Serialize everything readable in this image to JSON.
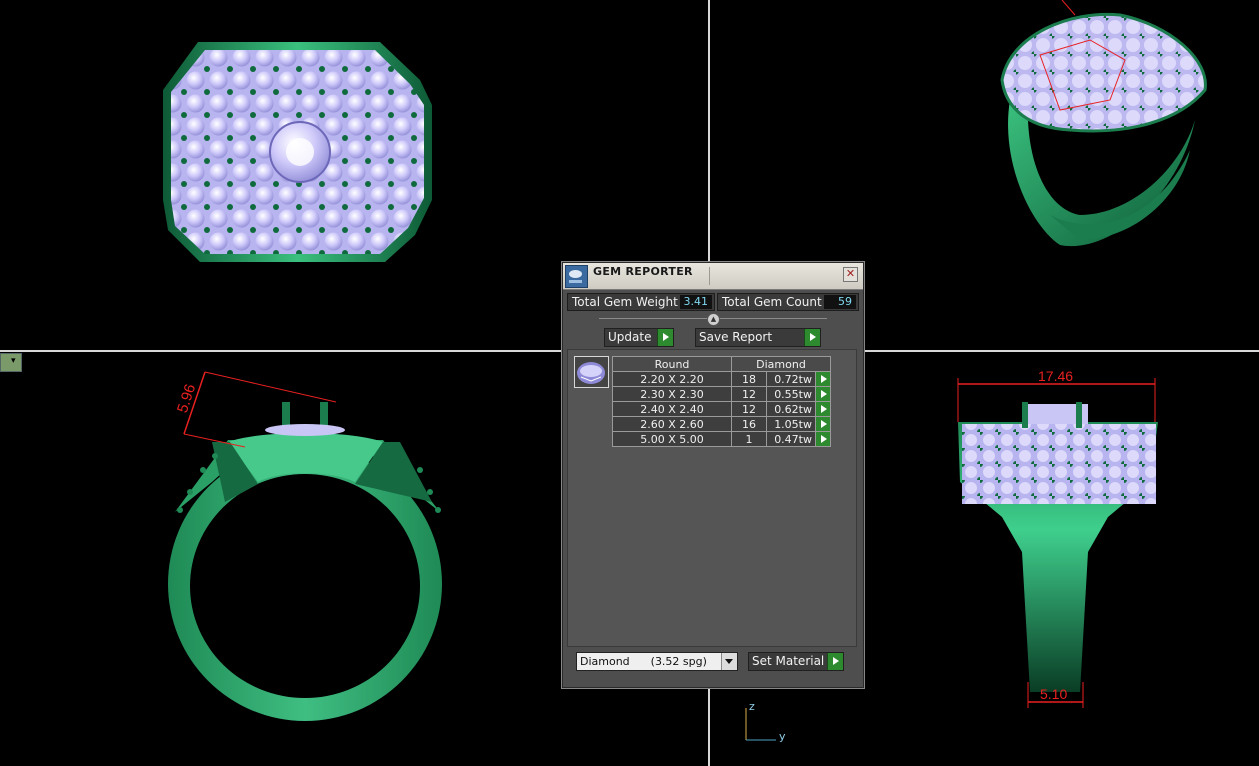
{
  "dialog": {
    "title": "GEM REPORTER",
    "close_label": "✕",
    "total_gem_weight_label": "Total Gem Weight",
    "total_gem_weight_value": "3.41",
    "total_gem_count_label": "Total Gem Count",
    "total_gem_count_value": "59",
    "update_label": "Update",
    "save_report_label": "Save Report",
    "table": {
      "headers": [
        "Round",
        "Diamond"
      ],
      "rows": [
        {
          "size": "2.20 X 2.20",
          "qty": "18",
          "weight": "0.72tw"
        },
        {
          "size": "2.30 X 2.30",
          "qty": "12",
          "weight": "0.55tw"
        },
        {
          "size": "2.40 X 2.40",
          "qty": "12",
          "weight": "0.62tw"
        },
        {
          "size": "2.60 X 2.60",
          "qty": "16",
          "weight": "1.05tw"
        },
        {
          "size": "5.00 X 5.00",
          "qty": "1",
          "weight": "0.47tw"
        }
      ]
    },
    "material_select": "Diamond      (3.52 spg)",
    "set_material_label": "Set Material"
  },
  "viewports": {
    "bottom_left": {
      "dimension": "5.96"
    },
    "bottom_right": {
      "width_dimension": "17.46",
      "shank_dimension": "5.10"
    },
    "axis": {
      "z": "z",
      "y": "y"
    }
  },
  "colors": {
    "metal": "#2fa86a",
    "gem": "#c9c6f5",
    "dimension": "#e82020",
    "button_accent": "#2e8a2e"
  }
}
